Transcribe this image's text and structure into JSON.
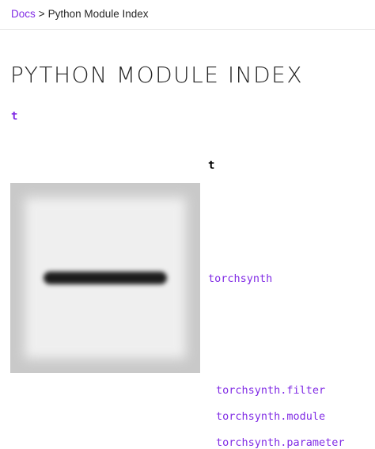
{
  "breadcrumb": {
    "root_label": "Docs",
    "separator": ">",
    "current_label": "Python Module Index"
  },
  "page": {
    "title": "PYTHON MODULE INDEX"
  },
  "index": {
    "letters": [
      "t"
    ],
    "section_letter": "t",
    "modules": [
      "torchsynth",
      "torchsynth.filter",
      "torchsynth.module",
      "torchsynth.parameter"
    ]
  },
  "colors": {
    "link": "#812ce5",
    "text": "#262626",
    "divider": "#e6e6e6",
    "toggle_frame": "#c9c9c9",
    "toggle_fill": "#efefef",
    "toggle_glyph": "#1c1c1c"
  },
  "icons": {
    "toggle": "minus-icon"
  }
}
